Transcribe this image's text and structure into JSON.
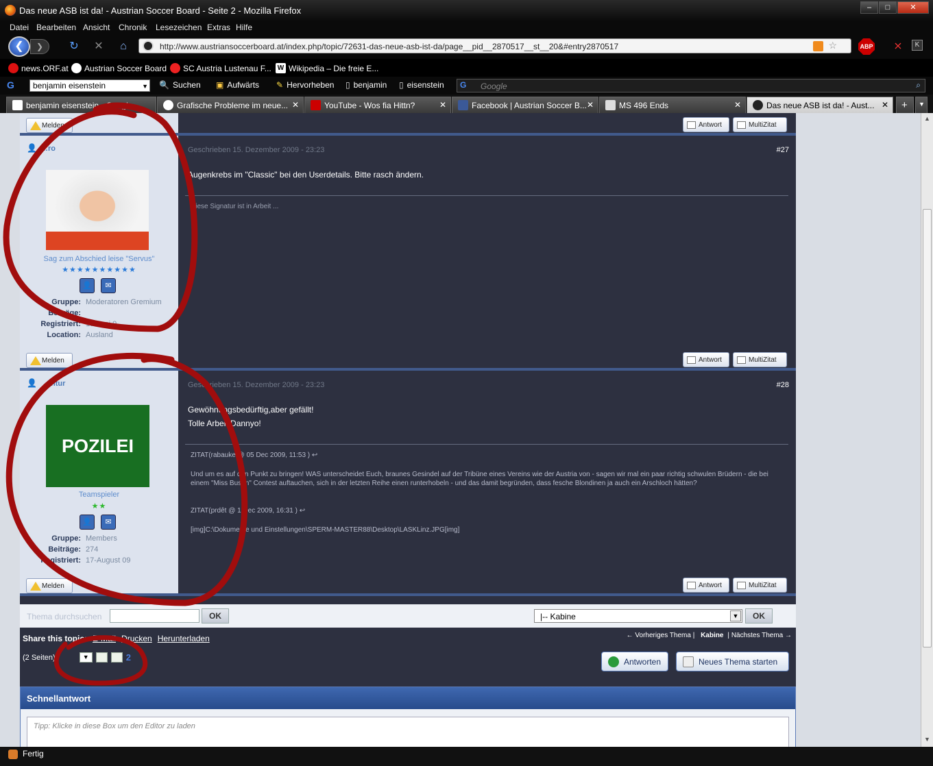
{
  "window": {
    "title": "Das neue ASB ist da! - Austrian Soccer Board - Seite 2 - Mozilla Firefox",
    "buttons": {
      "minimize": "–",
      "maximize": "□",
      "close": "✕"
    }
  },
  "menu": [
    "Datei",
    "Bearbeiten",
    "Ansicht",
    "Chronik",
    "Lesezeichen",
    "Extras",
    "Hilfe"
  ],
  "url": "http://www.austriansoccerboard.at/index.php/topic/72631-das-neue-asb-ist-da/page__pid__2870517__st__20&#entry2870517",
  "bookmarks": [
    "news.ORF.at",
    "Austrian Soccer Board",
    "SC Austria Lustenau F...",
    "Wikipedia – Die freie E..."
  ],
  "google_toolbar": {
    "search_value": "benjamin eisenstein",
    "suchen": "Suchen",
    "aufwaerts": "Aufwärts",
    "hervorheben": "Hervorheben",
    "term1": "benjamin",
    "term2": "eisenstein",
    "placeholder": "Google"
  },
  "tabs": [
    "benjamin eisenstein - Google...",
    "Grafische Probleme im neue...",
    "YouTube - Wos fia Hittn?",
    "Facebook | Austrian Soccer B...",
    "MS 496 Ends",
    "Das neue ASB ist da! - Aust..."
  ],
  "abp_label": "ABP",
  "buttons": {
    "melden": "Melden",
    "antwort": "Antwort",
    "multizitat": "MultiZitat",
    "ok": "OK",
    "antworten": "Antworten",
    "neues_thema": "Neues Thema starten"
  },
  "posts": [
    {
      "username": "…ro",
      "date": "Geschrieben 15. Dezember 2009 - 23:23",
      "number": "#27",
      "body": [
        "Augenkrebs im \"Classic\" bei den Userdetails. Bitte rasch ändern."
      ],
      "signature": "Diese Signatur ist in Arbeit ...",
      "user_title": "Sag zum Abschied leise \"Servus\"",
      "stars": "★★★★★★★★★★",
      "star_color": "#2a7ad8",
      "fields": [
        {
          "k": "Gruppe:",
          "v": "Moderatoren Gremium"
        },
        {
          "k": "Beiträge:",
          "v": ""
        },
        {
          "k": "Registriert:",
          "v": "19-Juni 0"
        },
        {
          "k": "Location:",
          "v": "Ausland"
        }
      ]
    },
    {
      "username": "…ntur",
      "date": "Geschrieben 15. Dezember 2009 - 23:23",
      "number": "#28",
      "body": [
        "Gewöhnungsbedürftig,aber gefällt!",
        "Tolle Arbeit Dannyo!"
      ],
      "quote1_head": "ZITAT(rabauke @ 05 Dec 2009, 11:53 )",
      "quote1_text": "Und um es auf den Punkt zu bringen! WAS unterscheidet Euch, braunes Gesindel auf der Tribüne eines Vereins wie der Austria von - sagen wir mal ein paar richtig schwulen Brüdern - die bei einem \"Miss Busen\" Contest auftauchen, sich in der letzten Reihe einen runterhobeln - und das damit begründen, dass fesche Blondinen ja auch ein Arschloch hätten?",
      "quote2_head": "ZITAT(prdêt @ 1 Dec 2009, 16:31 )",
      "quote2_text": "[img]C:\\Dokumente und Einstellungen\\SPERM-MASTER88\\Desktop\\LASKLinz.JPG[img]",
      "avatar_text": "POZILEI",
      "user_title": "Teamspieler",
      "stars": "★★",
      "star_color": "#2ab82a",
      "fields": [
        {
          "k": "Gruppe:",
          "v": "Members"
        },
        {
          "k": "Beiträge:",
          "v": "274"
        },
        {
          "k": "Registriert:",
          "v": "17-August 09"
        }
      ]
    }
  ],
  "search": {
    "label": "Thema durchsuchen",
    "forum_select": "|-- Kabine"
  },
  "share": {
    "label": "Share this topic:",
    "email": "E-Mail",
    "print": "Drucken",
    "download": "Herunterladen"
  },
  "thread_nav": {
    "prev": "← Vorheriges Thema",
    "current": "Kabine",
    "next": "Nächstes Thema →"
  },
  "pagination": {
    "label": "(2 Seiten)",
    "page": "2"
  },
  "quick_reply": {
    "title": "Schnellantwort",
    "hint": "Tipp: Klicke in diese Box um den Editor zu laden"
  },
  "status": "Fertig"
}
